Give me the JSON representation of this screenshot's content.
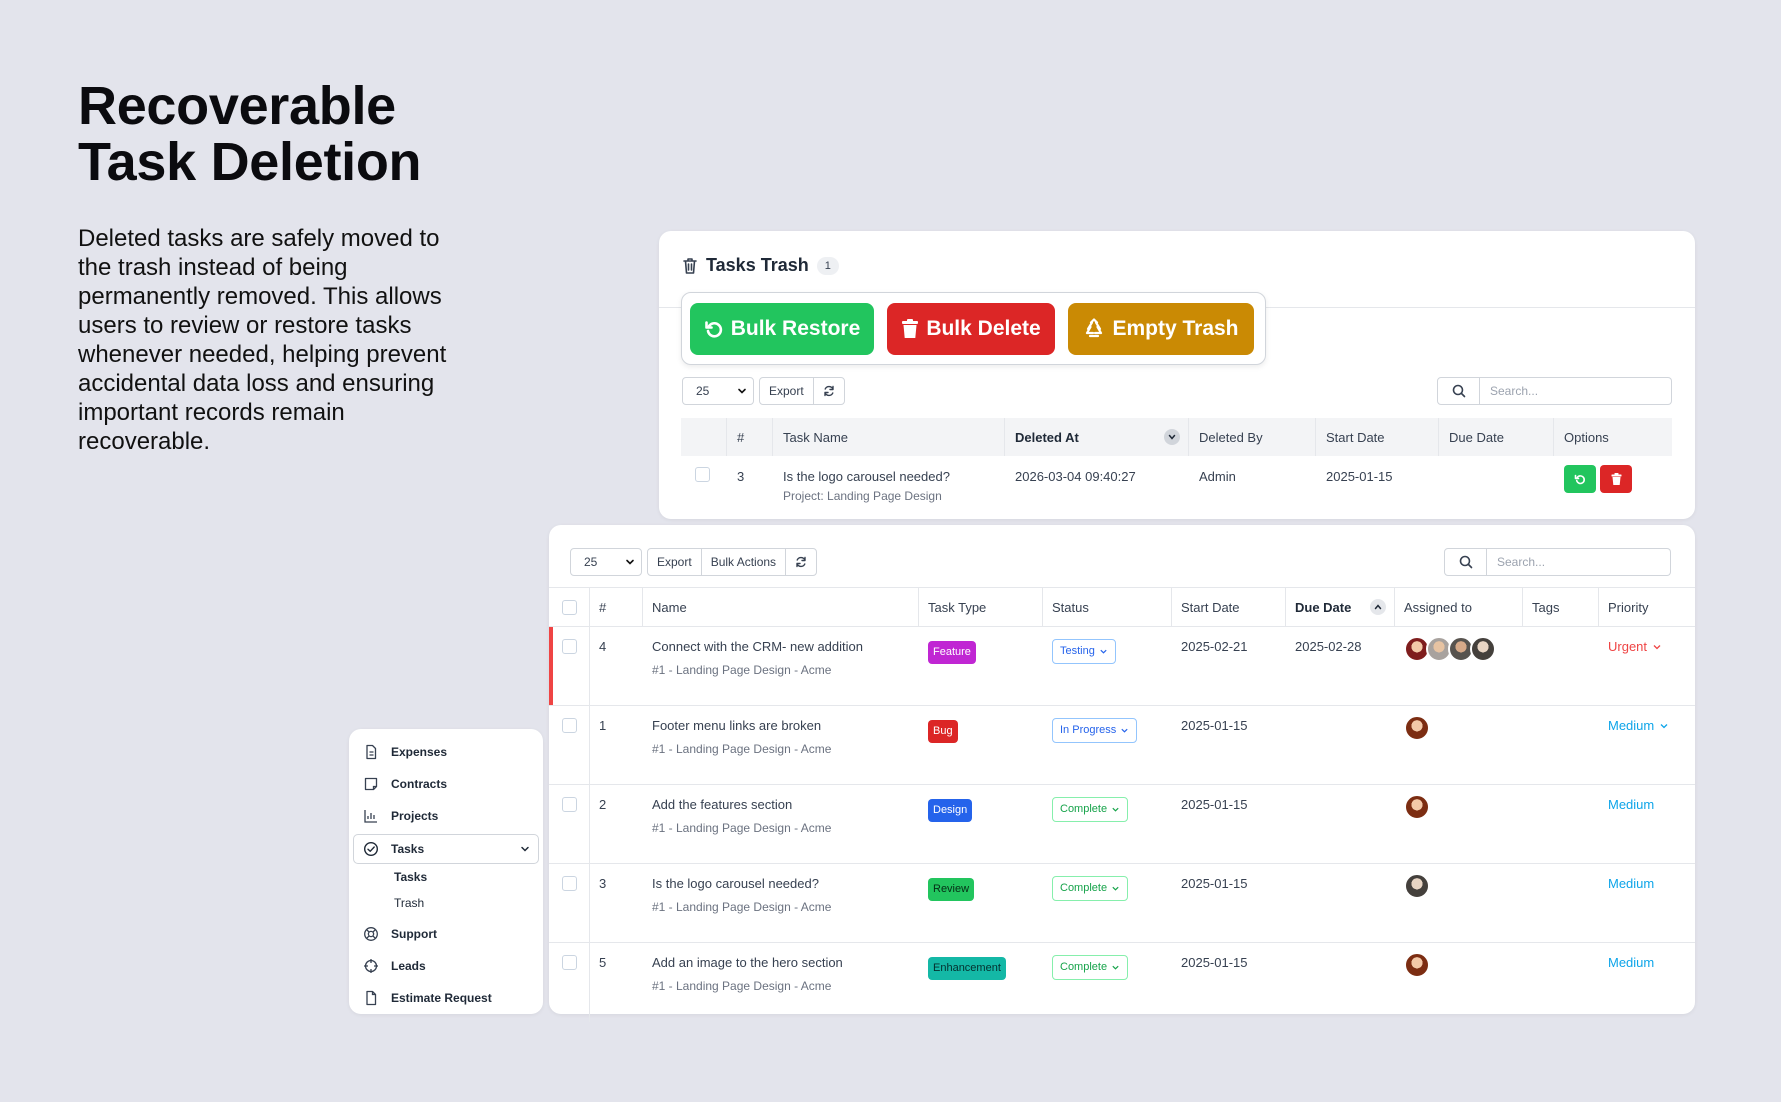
{
  "hero": {
    "title_line1": "Recoverable",
    "title_line2": "Task Deletion",
    "description": "Deleted tasks are safely moved to the trash instead of being permanently removed. This allows users to review or restore tasks whenever needed, helping prevent accidental data loss and ensuring important records remain recoverable."
  },
  "trash": {
    "title": "Tasks Trash",
    "count": "1",
    "bulk_restore_label": "Bulk Restore",
    "bulk_delete_label": "Bulk Delete",
    "empty_trash_label": "Empty Trash",
    "page_size": "25",
    "export_label": "Export",
    "search_placeholder": "Search...",
    "columns": [
      "#",
      "Task Name",
      "Deleted At",
      "Deleted By",
      "Start Date",
      "Due Date",
      "Options"
    ],
    "rows": [
      {
        "id": "3",
        "name": "Is the logo carousel needed?",
        "project": "Project: Landing Page Design",
        "deleted_at": "2026-03-04 09:40:27",
        "deleted_by": "Admin",
        "start_date": "2025-01-15",
        "due_date": ""
      }
    ]
  },
  "tasks": {
    "page_size": "25",
    "export_label": "Export",
    "bulk_actions_label": "Bulk Actions",
    "search_placeholder": "Search...",
    "columns": [
      "#",
      "Name",
      "Task Type",
      "Status",
      "Start Date",
      "Due Date",
      "Assigned to",
      "Tags",
      "Priority"
    ],
    "rows": [
      {
        "id": "4",
        "name": "Connect with the CRM- new addition",
        "project": "#1 - Landing Page Design - Acme",
        "type": "Feature",
        "status": "Testing",
        "start_date": "2025-02-21",
        "due_date": "2025-02-28",
        "priority": "Urgent"
      },
      {
        "id": "1",
        "name": "Footer menu links are broken",
        "project": "#1 - Landing Page Design - Acme",
        "type": "Bug",
        "status": "In Progress",
        "start_date": "2025-01-15",
        "due_date": "",
        "priority": "Medium"
      },
      {
        "id": "2",
        "name": "Add the features section",
        "project": "#1 - Landing Page Design - Acme",
        "type": "Design",
        "status": "Complete",
        "start_date": "2025-01-15",
        "due_date": "",
        "priority": "Medium"
      },
      {
        "id": "3",
        "name": "Is the logo carousel needed?",
        "project": "#1 - Landing Page Design - Acme",
        "type": "Review",
        "status": "Complete",
        "start_date": "2025-01-15",
        "due_date": "",
        "priority": "Medium"
      },
      {
        "id": "5",
        "name": "Add an image to the hero section",
        "project": "#1 - Landing Page Design - Acme",
        "type": "Enhancement",
        "status": "Complete",
        "start_date": "2025-01-15",
        "due_date": "",
        "priority": "Medium"
      }
    ]
  },
  "sidebar": {
    "items": [
      {
        "label": "Expenses",
        "icon": "file-icon"
      },
      {
        "label": "Contracts",
        "icon": "contract-icon"
      },
      {
        "label": "Projects",
        "icon": "chart-icon"
      },
      {
        "label": "Tasks",
        "icon": "check-circle-icon"
      },
      {
        "label": "Support",
        "icon": "lifebuoy-icon"
      },
      {
        "label": "Leads",
        "icon": "crosshair-icon"
      },
      {
        "label": "Estimate Request",
        "icon": "document-icon"
      }
    ],
    "sub_items": [
      {
        "label": "Tasks"
      },
      {
        "label": "Trash"
      }
    ]
  },
  "colors": {
    "restore": "#22c55e",
    "delete": "#dc2626",
    "empty_trash": "#ca8a04",
    "feature": "#c026d3",
    "bug": "#dc2626",
    "design": "#2563eb",
    "review": "#22c55e",
    "enhancement": "#14b8a6",
    "urgent": "#ef4444",
    "medium": "#0ea5e9"
  }
}
